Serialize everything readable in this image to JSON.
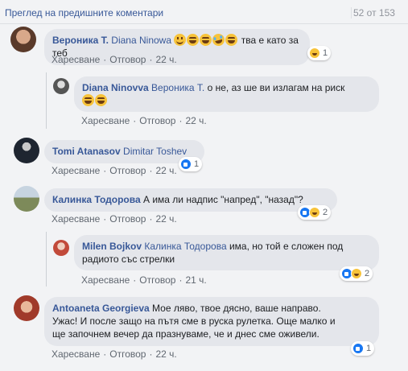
{
  "header": {
    "more_comments": "Преглед на предишните коментари",
    "counter": "52 от 153"
  },
  "actions": {
    "like": "Харесване",
    "reply": "Отговор"
  },
  "comments": [
    {
      "author": "Вероника Т.",
      "mention": "Diana Ninowa",
      "text": " тва е като за теб",
      "time": "22 ч.",
      "emojis": [
        "smile",
        "laugh",
        "laugh",
        "tear",
        "laugh"
      ],
      "reactions": {
        "types": [
          "haha"
        ],
        "count": "1"
      },
      "avatar_color": "#8a5a44"
    },
    {
      "author": "Diana Ninovva",
      "mention": "Вероника Т.",
      "text": " о не, аз ше ви излагам на риск",
      "time": "22 ч.",
      "emojis": [
        "laugh",
        "laugh"
      ],
      "reply": true,
      "avatar_color": "#6b6b6b"
    },
    {
      "author": "Tomi Atanasov",
      "mention": "Dimitar Toshev",
      "text": "",
      "time": "22 ч.",
      "reactions": {
        "types": [
          "like"
        ],
        "count": "1"
      },
      "avatar_color": "#2d3440"
    },
    {
      "author": "Калинка Тодорова",
      "mention": "",
      "text": "А има ли надпис \"напред\", \"назад\"?",
      "time": "22 ч.",
      "reactions": {
        "types": [
          "like",
          "haha"
        ],
        "count": "2"
      },
      "avatar_color": "#8e9a7a"
    },
    {
      "author": "Milen Bojkov",
      "mention": "Калинка Тодорова",
      "text_line1": " има, но той е сложен под",
      "text_line2": "радиото със стрелки",
      "time": "21 ч.",
      "reply": true,
      "reactions": {
        "types": [
          "like",
          "haha"
        ],
        "count": "2"
      },
      "avatar_color": "#c24a3a"
    },
    {
      "author": "Antoaneta Georgieva",
      "text_line1": " Мое ляво, твое дясно, ваше направо.",
      "text_line2": "Ужас! И после защо на пътя сме в руска рулетка. Още малко и",
      "text_line3": "ще започнем вечер да празнуваме, че и днес сме оживели.",
      "time": "22 ч.",
      "reactions": {
        "types": [
          "like"
        ],
        "count": "1"
      },
      "avatar_color": "#a03a2a"
    }
  ]
}
